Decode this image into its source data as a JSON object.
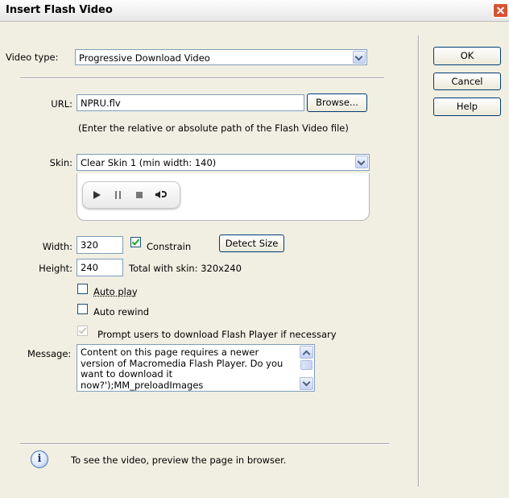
{
  "window": {
    "title": "Insert Flash Video"
  },
  "video_type": {
    "label": "Video type:",
    "selected": "Progressive Download Video"
  },
  "url": {
    "label": "URL:",
    "value": "NPRU.flv",
    "browse_label": "Browse...",
    "hint": "(Enter the relative or absolute path of the Flash Video file)"
  },
  "skin": {
    "label": "Skin:",
    "selected": "Clear Skin 1 (min width: 140)"
  },
  "size": {
    "width_label": "Width:",
    "width_value": "320",
    "constrain_label": "Constrain",
    "constrain_checked": true,
    "detect_label": "Detect Size",
    "height_label": "Height:",
    "height_value": "240",
    "total_text": "Total with skin: 320x240"
  },
  "options": {
    "auto_play_label": "Auto play",
    "auto_play_checked": false,
    "auto_rewind_label": "Auto rewind",
    "auto_rewind_checked": false,
    "prompt_label": "Prompt users to download Flash Player if necessary",
    "prompt_checked": true
  },
  "message": {
    "label": "Message:",
    "text": "Content on this page requires a newer version of Macromedia Flash Player. Do you want to download it now?');MM_preloadImages"
  },
  "buttons": {
    "ok": "OK",
    "cancel": "Cancel",
    "help": "Help"
  },
  "footer": {
    "info_text": "To see the video, preview the page in browser."
  }
}
